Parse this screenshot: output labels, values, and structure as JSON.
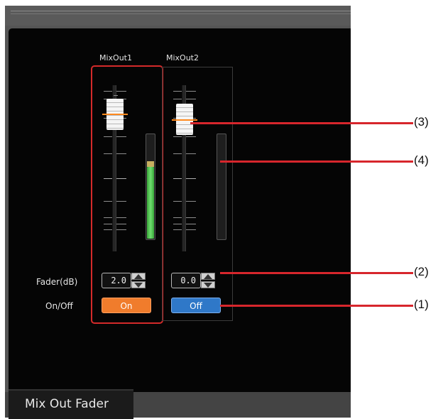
{
  "panel": {
    "tab_label": "Mix Out Fader"
  },
  "channels": [
    {
      "name": "MixOut1",
      "fader_db": "2.0",
      "onoff_label": "On"
    },
    {
      "name": "MixOut2",
      "fader_db": "0.0",
      "onoff_label": "Off"
    }
  ],
  "row_labels": {
    "fader": "Fader(dB)",
    "onoff": "On/Off"
  },
  "meters": [
    {
      "channel": "MixOut1",
      "level": 0.75
    },
    {
      "channel": "MixOut2",
      "level": 0.0
    }
  ],
  "callouts": [
    "(1)",
    "(2)",
    "(3)",
    "(4)"
  ],
  "colors": {
    "highlight": "#d42a2a",
    "on_button": "#f07c2c",
    "off_button": "#2f78c8",
    "meter": "#4fbf4f"
  }
}
